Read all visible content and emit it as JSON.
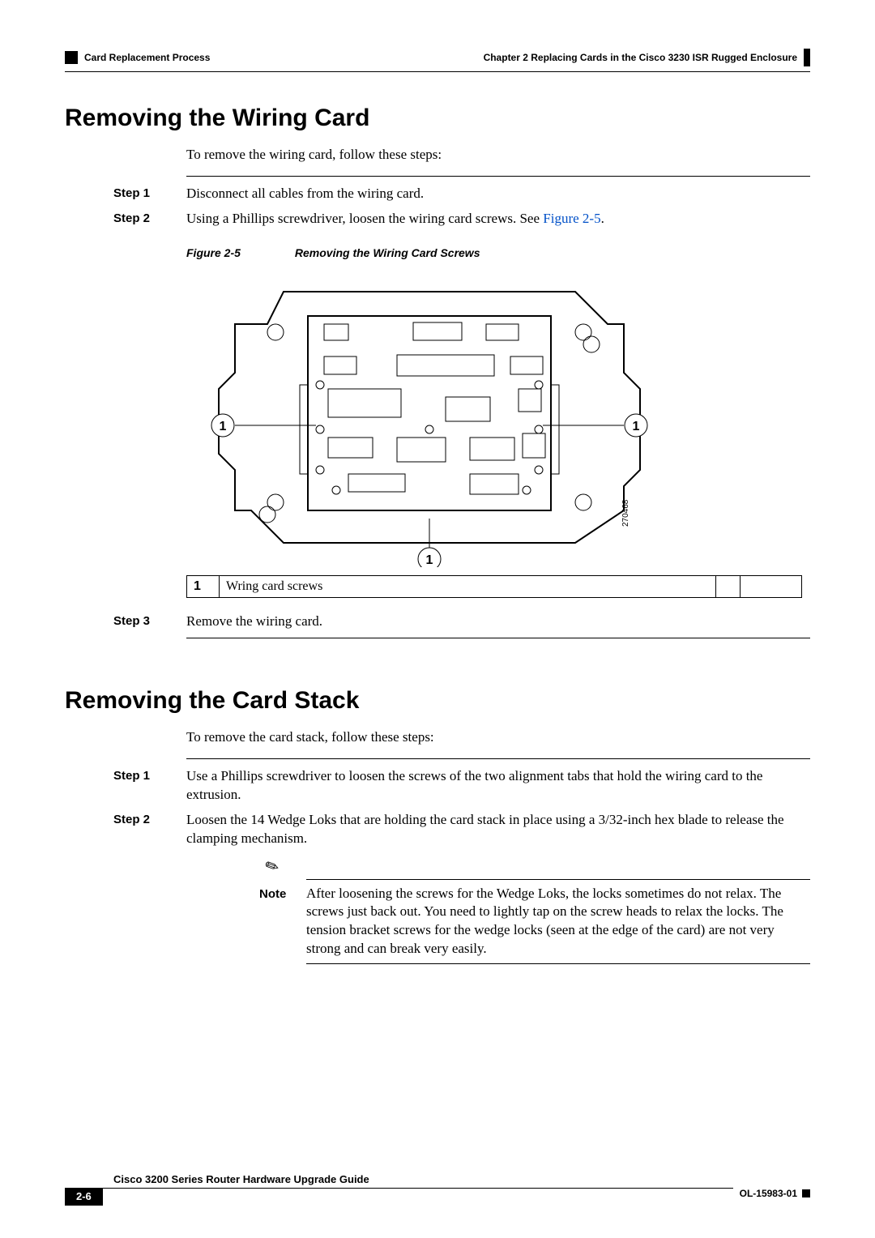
{
  "header": {
    "section": "Card Replacement Process",
    "chapter": "Chapter 2      Replacing Cards in the Cisco 3230 ISR Rugged Enclosure"
  },
  "section1": {
    "title": "Removing the Wiring Card",
    "intro": "To remove the wiring card, follow these steps:",
    "steps": [
      {
        "label": "Step 1",
        "text": "Disconnect all cables from the wiring card."
      },
      {
        "label": "Step 2",
        "text_pre": "Using a Phillips screwdriver, loosen the wiring card screws. See ",
        "link": "Figure 2-5",
        "text_post": "."
      },
      {
        "label": "Step 3",
        "text": "Remove the wiring card."
      }
    ],
    "figure": {
      "num": "Figure 2-5",
      "title": "Removing the Wiring Card Screws",
      "drawing_id": "270468",
      "callouts": [
        "1",
        "1",
        "1"
      ]
    },
    "callout_table": {
      "num": "1",
      "desc": "Wring card screws"
    }
  },
  "section2": {
    "title": "Removing the Card Stack",
    "intro": "To remove the card stack, follow these steps:",
    "steps": [
      {
        "label": "Step 1",
        "text": "Use a Phillips screwdriver to loosen the screws of the two alignment tabs that hold the wiring card to the extrusion."
      },
      {
        "label": "Step 2",
        "text": "Loosen the 14 Wedge Loks that are holding the card stack in place using a 3/32-inch hex blade to release the clamping mechanism."
      }
    ],
    "note": {
      "label": "Note",
      "text": "After loosening the screws for the Wedge Loks, the locks sometimes do not relax. The screws just back out. You need to lightly tap on the screw heads to relax the locks. The tension bracket screws for the wedge locks (seen at the edge of the card) are not very strong and can break very easily."
    }
  },
  "footer": {
    "book": "Cisco 3200 Series Router Hardware Upgrade Guide",
    "page": "2-6",
    "docid": "OL-15983-01"
  }
}
